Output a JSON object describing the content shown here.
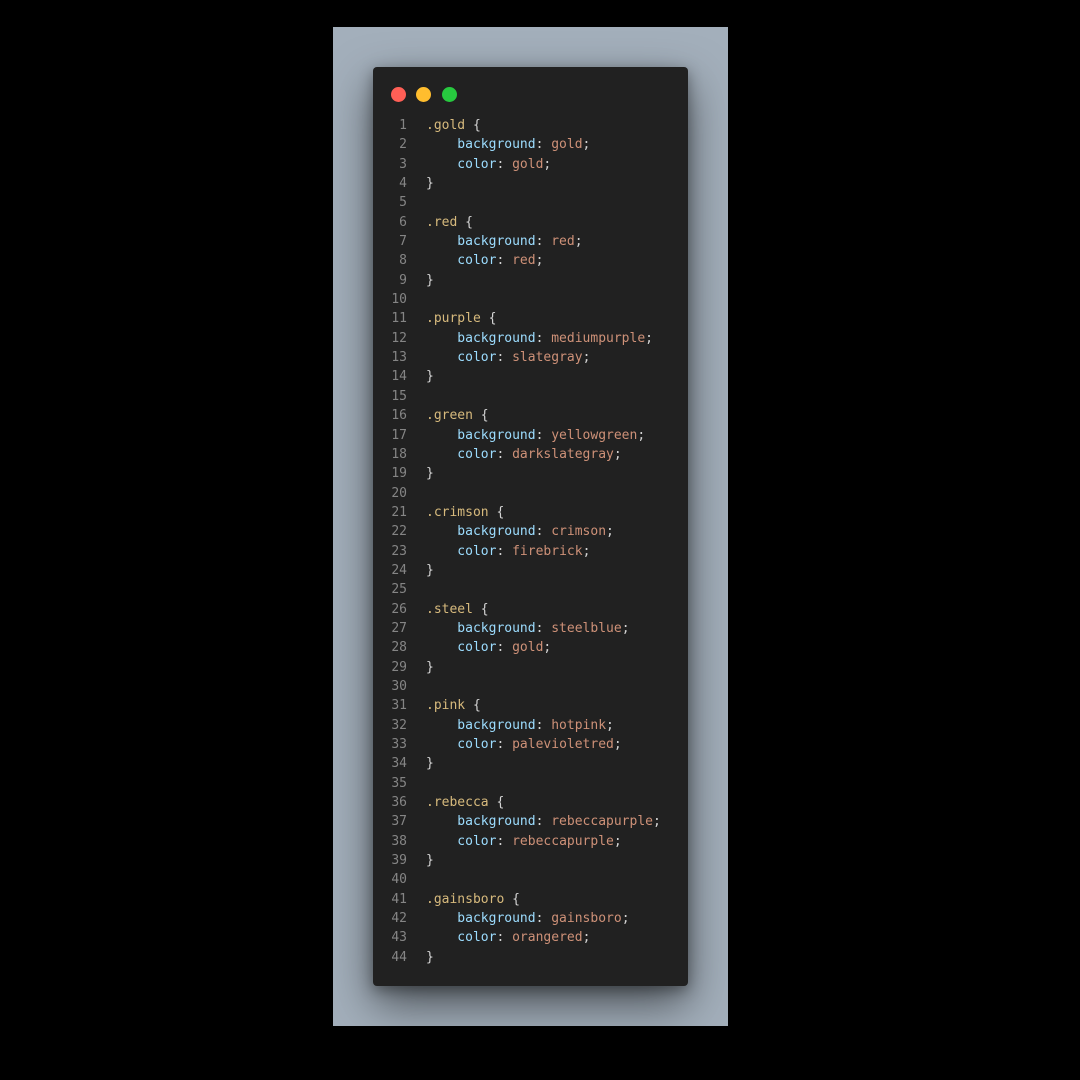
{
  "colors": {
    "outer_background": "#000000",
    "canvas_background": "#a3afbb",
    "window_background": "#212121",
    "close_dot": "#ff5f56",
    "minimize_dot": "#ffbd2e",
    "zoom_dot": "#27c93f",
    "line_number": "#858585",
    "selector": "#d7ba7d",
    "property": "#9cdcfe",
    "value": "#ce9178",
    "punctuation": "#d4d4d4"
  },
  "window": {
    "controls": [
      "close-dot",
      "minimize-dot",
      "zoom-dot"
    ]
  },
  "code": {
    "language": "css",
    "lines": [
      {
        "n": "1",
        "tokens": [
          {
            "t": ".gold",
            "k": "sel"
          },
          {
            "t": " {",
            "k": "pun"
          }
        ]
      },
      {
        "n": "2",
        "tokens": [
          {
            "t": "    background",
            "k": "prop"
          },
          {
            "t": ": ",
            "k": "pun"
          },
          {
            "t": "gold",
            "k": "val"
          },
          {
            "t": ";",
            "k": "pun"
          }
        ]
      },
      {
        "n": "3",
        "tokens": [
          {
            "t": "    color",
            "k": "prop"
          },
          {
            "t": ": ",
            "k": "pun"
          },
          {
            "t": "gold",
            "k": "val"
          },
          {
            "t": ";",
            "k": "pun"
          }
        ]
      },
      {
        "n": "4",
        "tokens": [
          {
            "t": "}",
            "k": "pun"
          }
        ]
      },
      {
        "n": "5",
        "tokens": []
      },
      {
        "n": "6",
        "tokens": [
          {
            "t": ".red",
            "k": "sel"
          },
          {
            "t": " {",
            "k": "pun"
          }
        ]
      },
      {
        "n": "7",
        "tokens": [
          {
            "t": "    background",
            "k": "prop"
          },
          {
            "t": ": ",
            "k": "pun"
          },
          {
            "t": "red",
            "k": "val"
          },
          {
            "t": ";",
            "k": "pun"
          }
        ]
      },
      {
        "n": "8",
        "tokens": [
          {
            "t": "    color",
            "k": "prop"
          },
          {
            "t": ": ",
            "k": "pun"
          },
          {
            "t": "red",
            "k": "val"
          },
          {
            "t": ";",
            "k": "pun"
          }
        ]
      },
      {
        "n": "9",
        "tokens": [
          {
            "t": "}",
            "k": "pun"
          }
        ]
      },
      {
        "n": "10",
        "tokens": []
      },
      {
        "n": "11",
        "tokens": [
          {
            "t": ".purple",
            "k": "sel"
          },
          {
            "t": " {",
            "k": "pun"
          }
        ]
      },
      {
        "n": "12",
        "tokens": [
          {
            "t": "    background",
            "k": "prop"
          },
          {
            "t": ": ",
            "k": "pun"
          },
          {
            "t": "mediumpurple",
            "k": "val"
          },
          {
            "t": ";",
            "k": "pun"
          }
        ]
      },
      {
        "n": "13",
        "tokens": [
          {
            "t": "    color",
            "k": "prop"
          },
          {
            "t": ": ",
            "k": "pun"
          },
          {
            "t": "slategray",
            "k": "val"
          },
          {
            "t": ";",
            "k": "pun"
          }
        ]
      },
      {
        "n": "14",
        "tokens": [
          {
            "t": "}",
            "k": "pun"
          }
        ]
      },
      {
        "n": "15",
        "tokens": []
      },
      {
        "n": "16",
        "tokens": [
          {
            "t": ".green",
            "k": "sel"
          },
          {
            "t": " {",
            "k": "pun"
          }
        ]
      },
      {
        "n": "17",
        "tokens": [
          {
            "t": "    background",
            "k": "prop"
          },
          {
            "t": ": ",
            "k": "pun"
          },
          {
            "t": "yellowgreen",
            "k": "val"
          },
          {
            "t": ";",
            "k": "pun"
          }
        ]
      },
      {
        "n": "18",
        "tokens": [
          {
            "t": "    color",
            "k": "prop"
          },
          {
            "t": ": ",
            "k": "pun"
          },
          {
            "t": "darkslategray",
            "k": "val"
          },
          {
            "t": ";",
            "k": "pun"
          }
        ]
      },
      {
        "n": "19",
        "tokens": [
          {
            "t": "}",
            "k": "pun"
          }
        ]
      },
      {
        "n": "20",
        "tokens": []
      },
      {
        "n": "21",
        "tokens": [
          {
            "t": ".crimson",
            "k": "sel"
          },
          {
            "t": " {",
            "k": "pun"
          }
        ]
      },
      {
        "n": "22",
        "tokens": [
          {
            "t": "    background",
            "k": "prop"
          },
          {
            "t": ": ",
            "k": "pun"
          },
          {
            "t": "crimson",
            "k": "val"
          },
          {
            "t": ";",
            "k": "pun"
          }
        ]
      },
      {
        "n": "23",
        "tokens": [
          {
            "t": "    color",
            "k": "prop"
          },
          {
            "t": ": ",
            "k": "pun"
          },
          {
            "t": "firebrick",
            "k": "val"
          },
          {
            "t": ";",
            "k": "pun"
          }
        ]
      },
      {
        "n": "24",
        "tokens": [
          {
            "t": "}",
            "k": "pun"
          }
        ]
      },
      {
        "n": "25",
        "tokens": []
      },
      {
        "n": "26",
        "tokens": [
          {
            "t": ".steel",
            "k": "sel"
          },
          {
            "t": " {",
            "k": "pun"
          }
        ]
      },
      {
        "n": "27",
        "tokens": [
          {
            "t": "    background",
            "k": "prop"
          },
          {
            "t": ": ",
            "k": "pun"
          },
          {
            "t": "steelblue",
            "k": "val"
          },
          {
            "t": ";",
            "k": "pun"
          }
        ]
      },
      {
        "n": "28",
        "tokens": [
          {
            "t": "    color",
            "k": "prop"
          },
          {
            "t": ": ",
            "k": "pun"
          },
          {
            "t": "gold",
            "k": "val"
          },
          {
            "t": ";",
            "k": "pun"
          }
        ]
      },
      {
        "n": "29",
        "tokens": [
          {
            "t": "}",
            "k": "pun"
          }
        ]
      },
      {
        "n": "30",
        "tokens": []
      },
      {
        "n": "31",
        "tokens": [
          {
            "t": ".pink",
            "k": "sel"
          },
          {
            "t": " {",
            "k": "pun"
          }
        ]
      },
      {
        "n": "32",
        "tokens": [
          {
            "t": "    background",
            "k": "prop"
          },
          {
            "t": ": ",
            "k": "pun"
          },
          {
            "t": "hotpink",
            "k": "val"
          },
          {
            "t": ";",
            "k": "pun"
          }
        ]
      },
      {
        "n": "33",
        "tokens": [
          {
            "t": "    color",
            "k": "prop"
          },
          {
            "t": ": ",
            "k": "pun"
          },
          {
            "t": "palevioletred",
            "k": "val"
          },
          {
            "t": ";",
            "k": "pun"
          }
        ]
      },
      {
        "n": "34",
        "tokens": [
          {
            "t": "}",
            "k": "pun"
          }
        ]
      },
      {
        "n": "35",
        "tokens": []
      },
      {
        "n": "36",
        "tokens": [
          {
            "t": ".rebecca",
            "k": "sel"
          },
          {
            "t": " {",
            "k": "pun"
          }
        ]
      },
      {
        "n": "37",
        "tokens": [
          {
            "t": "    background",
            "k": "prop"
          },
          {
            "t": ": ",
            "k": "pun"
          },
          {
            "t": "rebeccapurple",
            "k": "val"
          },
          {
            "t": ";",
            "k": "pun"
          }
        ]
      },
      {
        "n": "38",
        "tokens": [
          {
            "t": "    color",
            "k": "prop"
          },
          {
            "t": ": ",
            "k": "pun"
          },
          {
            "t": "rebeccapurple",
            "k": "val"
          },
          {
            "t": ";",
            "k": "pun"
          }
        ]
      },
      {
        "n": "39",
        "tokens": [
          {
            "t": "}",
            "k": "pun"
          }
        ]
      },
      {
        "n": "40",
        "tokens": []
      },
      {
        "n": "41",
        "tokens": [
          {
            "t": ".gainsboro",
            "k": "sel"
          },
          {
            "t": " {",
            "k": "pun"
          }
        ]
      },
      {
        "n": "42",
        "tokens": [
          {
            "t": "    background",
            "k": "prop"
          },
          {
            "t": ": ",
            "k": "pun"
          },
          {
            "t": "gainsboro",
            "k": "val"
          },
          {
            "t": ";",
            "k": "pun"
          }
        ]
      },
      {
        "n": "43",
        "tokens": [
          {
            "t": "    color",
            "k": "prop"
          },
          {
            "t": ": ",
            "k": "pun"
          },
          {
            "t": "orangered",
            "k": "val"
          },
          {
            "t": ";",
            "k": "pun"
          }
        ]
      },
      {
        "n": "44",
        "tokens": [
          {
            "t": "}",
            "k": "pun"
          }
        ]
      }
    ]
  }
}
